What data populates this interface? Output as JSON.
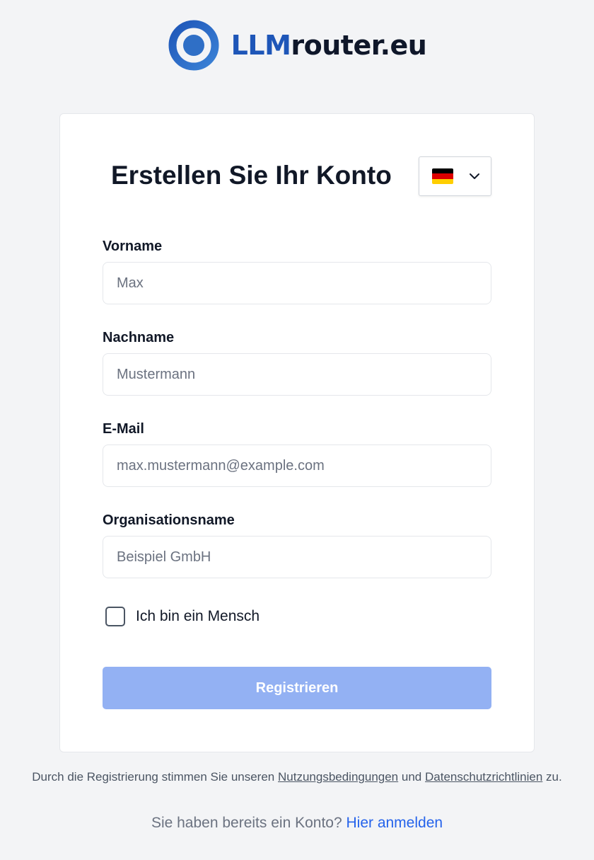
{
  "brand": {
    "name_part1": "LLM",
    "name_part2": "router.eu",
    "color_primary": "#1e56b8",
    "color_dark": "#0f172a"
  },
  "form": {
    "title": "Erstellen Sie Ihr Konto",
    "language": {
      "selected_flag_icon": "german-flag-icon",
      "flag_colors": [
        "#000000",
        "#dd0000",
        "#ffce00"
      ]
    },
    "fields": {
      "first_name": {
        "label": "Vorname",
        "placeholder": "Max",
        "value": ""
      },
      "last_name": {
        "label": "Nachname",
        "placeholder": "Mustermann",
        "value": ""
      },
      "email": {
        "label": "E-Mail",
        "placeholder": "max.mustermann@example.com",
        "value": ""
      },
      "organization": {
        "label": "Organisationsname",
        "placeholder": "Beispiel GmbH",
        "value": ""
      }
    },
    "human_check": {
      "label": "Ich bin ein Mensch",
      "checked": false
    },
    "submit": {
      "label": "Registrieren",
      "disabled_color": "#93b1f3"
    }
  },
  "footer": {
    "terms_prefix": "Durch die Registrierung stimmen Sie unseren",
    "terms_link": "Nutzungsbedingungen",
    "terms_and": "und",
    "privacy_link": "Datenschutzrichtlinien",
    "terms_suffix": "zu.",
    "login_prompt": "Sie haben bereits ein Konto?",
    "login_link": "Hier anmelden",
    "link_color": "#2563eb"
  }
}
